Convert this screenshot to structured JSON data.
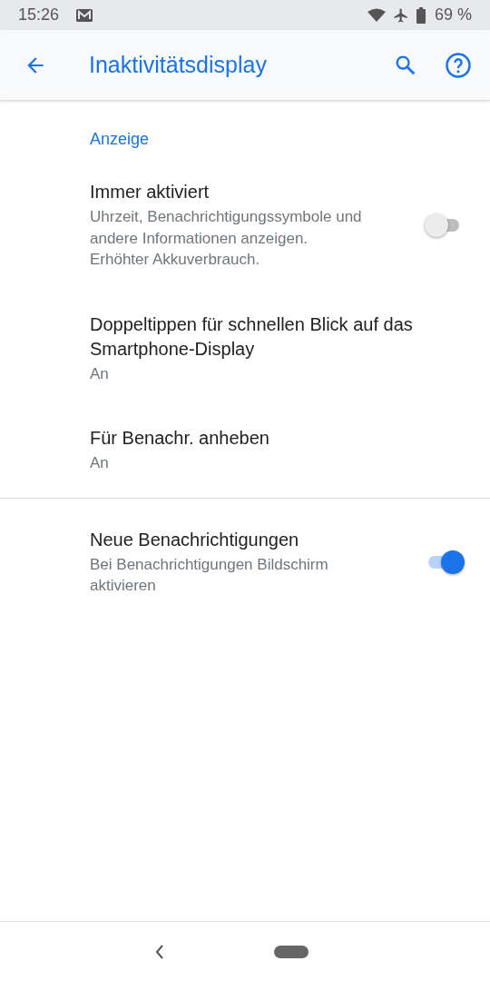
{
  "status_bar": {
    "time": "15:26",
    "battery": "69 %"
  },
  "app_bar": {
    "title": "Inaktivitätsdisplay"
  },
  "groups": [
    {
      "header": "Anzeige",
      "items": [
        {
          "kind": "toggle",
          "title": "Immer aktiviert",
          "summary": "Uhrzeit, Benachrichtigungssymbole und andere Informationen anzeigen. Erhöhter Akkuverbrauch.",
          "on": false
        },
        {
          "kind": "plain",
          "title": "Doppeltippen für schnellen Blick auf das Smartphone-Display",
          "summary": "An"
        },
        {
          "kind": "plain",
          "title": "Für Benachr. anheben",
          "summary": "An"
        }
      ]
    },
    {
      "items": [
        {
          "kind": "toggle",
          "title": "Neue Benachrichtigungen",
          "summary": "Bei Benachrichtigungen Bildschirm aktivieren",
          "on": true
        }
      ]
    }
  ]
}
